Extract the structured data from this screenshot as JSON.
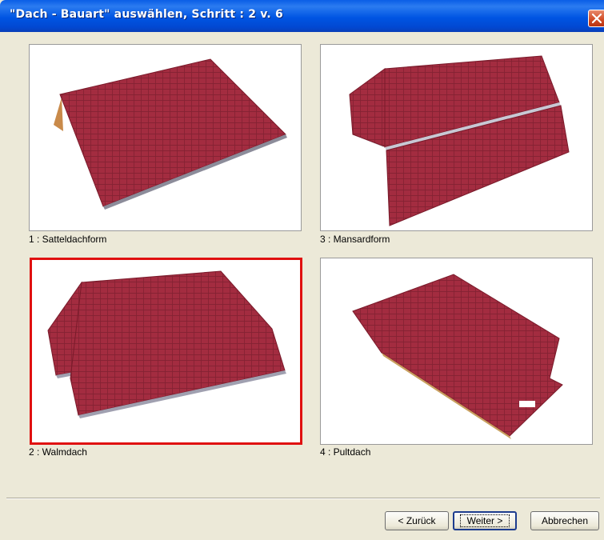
{
  "window": {
    "title": "\"Dach - Bauart\" auswählen, Schritt : 2 v. 6"
  },
  "options": [
    {
      "label": "1 : Satteldachform"
    },
    {
      "label": "3 : Mansardform"
    },
    {
      "label": "2 : Walmdach",
      "selected": true
    },
    {
      "label": "4 : Pultdach"
    }
  ],
  "buttons": {
    "back": "< Zurück",
    "next": "Weiter >",
    "cancel": "Abbrechen"
  },
  "colors": {
    "titlebar": "#0055e3",
    "selection_border": "#e01010",
    "roof": "#9e2a3c"
  }
}
